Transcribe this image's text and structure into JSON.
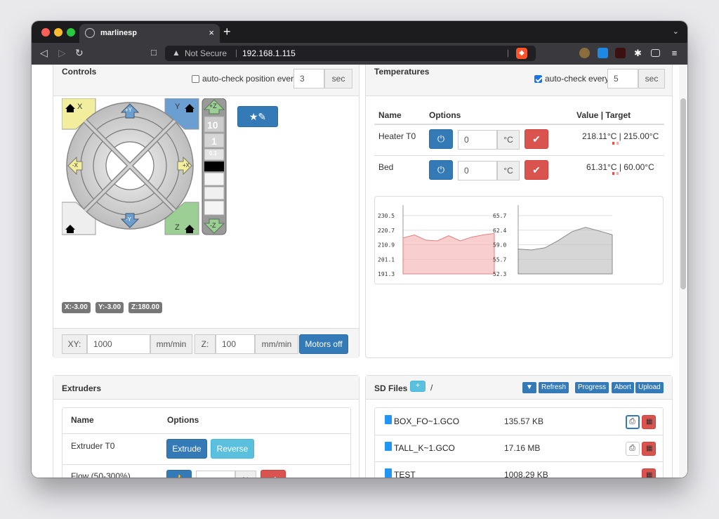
{
  "browser": {
    "tab_title": "marlinesp",
    "tab_close": "×",
    "new_tab": "+",
    "security_label": "Not Secure",
    "url_host": "192.168.1.115"
  },
  "controls": {
    "title": "Controls",
    "auto_check_label": "auto-check position every:",
    "auto_check_value": "3",
    "auto_check_unit": "sec",
    "jog": {
      "home_x_label": "X",
      "home_y_label": "Y",
      "home_z_label": "Z",
      "plus_z": "+Z",
      "minus_z": "-Z",
      "plus_y": "+Y",
      "minus_y": "-Y",
      "plus_x": "+X",
      "minus_x": "-X",
      "step_10": "10",
      "step_1": "1",
      "step_01": "0.1"
    },
    "position": {
      "x": "X:-3.00",
      "y": "Y:-3.00",
      "z": "Z:180.00"
    },
    "xy_label": "XY:",
    "xy_value": "1000",
    "xy_unit": "mm/min",
    "z_label": "Z:",
    "z_value": "100",
    "z_unit": "mm/min",
    "motors_off": "Motors off"
  },
  "temperatures": {
    "title": "Temperatures",
    "auto_check_label": "auto-check every:",
    "auto_check_value": "5",
    "auto_check_unit": "sec",
    "headers": {
      "name": "Name",
      "options": "Options",
      "value": "Value | Target"
    },
    "rows": [
      {
        "name": "Heater T0",
        "input": "0",
        "unit": "°C",
        "value": "218.11°C | 215.00°C"
      },
      {
        "name": "Bed",
        "input": "0",
        "unit": "°C",
        "value": "61.31°C | 60.00°C"
      }
    ]
  },
  "chart_data": [
    {
      "type": "area",
      "y_ticks": [
        "230.5",
        "220.7",
        "210.9",
        "201.1",
        "191.3"
      ],
      "ylim": [
        191.3,
        230.5
      ],
      "values": [
        215.5,
        217.5,
        214,
        213.5,
        217,
        213.5,
        216,
        217.5,
        218.5
      ],
      "color": "#f4a6a6"
    },
    {
      "type": "area",
      "y_ticks": [
        "65.7",
        "62.4",
        "59.0",
        "55.7",
        "52.3"
      ],
      "ylim": [
        52.3,
        65.7
      ],
      "values": [
        58,
        57.8,
        58.3,
        60,
        62,
        63,
        62.2,
        61.3
      ],
      "color": "#bbbbbb"
    }
  ],
  "extruders": {
    "title": "Extruders",
    "headers": {
      "name": "Name",
      "options": "Options"
    },
    "extruder_name": "Extruder T0",
    "extrude": "Extrude",
    "reverse": "Reverse",
    "flow_label": "Flow (50-300%)",
    "flow_unit": "%"
  },
  "sdfiles": {
    "title": "SD Files",
    "path": "/",
    "refresh": "Refresh",
    "progress": "Progress",
    "abort": "Abort",
    "upload": "Upload",
    "files": [
      {
        "name": "BOX_FO~1.GCO",
        "size": "135.57 KB",
        "printable": true
      },
      {
        "name": "TALL_K~1.GCO",
        "size": "17.16 MB",
        "printable": true
      },
      {
        "name": "TEST",
        "size": "1008.29 KB",
        "printable": false
      }
    ]
  }
}
